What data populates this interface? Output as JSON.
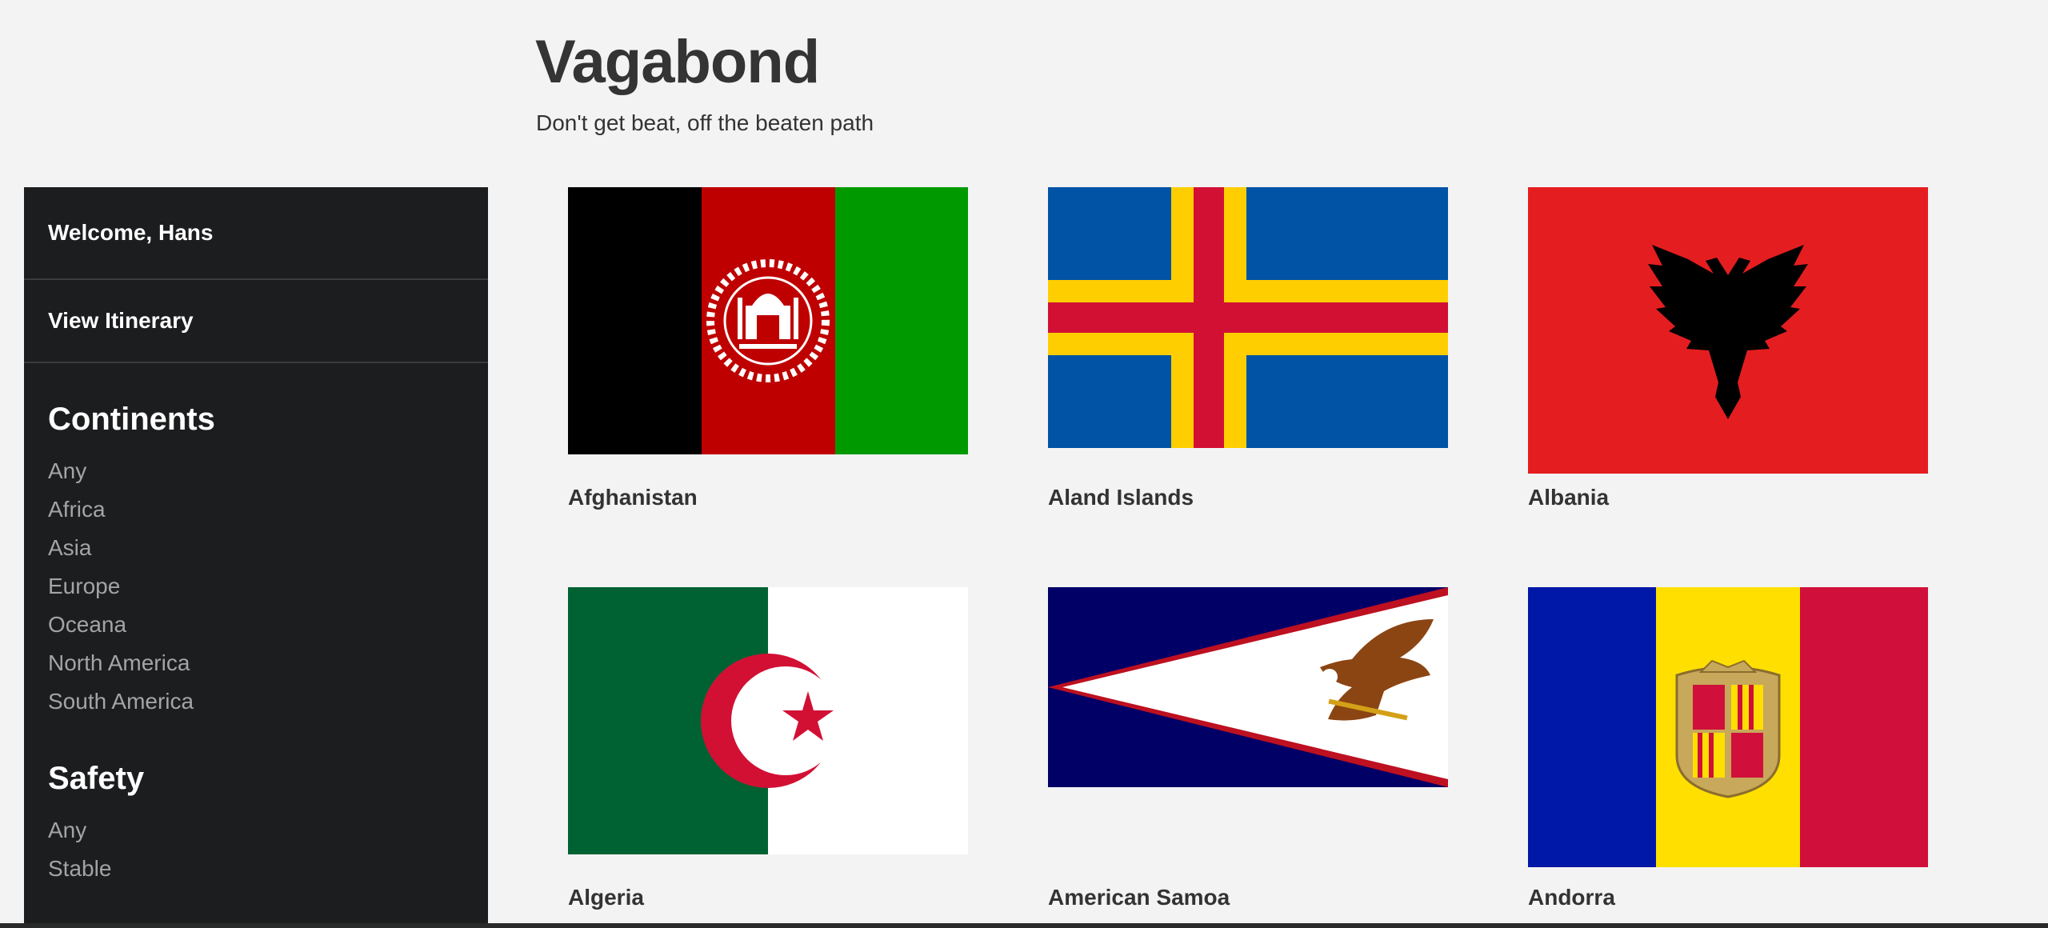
{
  "site": {
    "title": "Vagabond",
    "tagline": "Don't get beat, off the beaten path"
  },
  "sidebar": {
    "welcome": "Welcome, Hans",
    "itinerary": "View Itinerary",
    "continents_heading": "Continents",
    "continents": [
      "Any",
      "Africa",
      "Asia",
      "Europe",
      "Oceana",
      "North America",
      "South America"
    ],
    "safety_heading": "Safety",
    "safety": [
      "Any",
      "Stable"
    ]
  },
  "countries": [
    {
      "name": "Afghanistan",
      "flag_icon": "afghanistan-flag-icon"
    },
    {
      "name": "Aland Islands",
      "flag_icon": "aland-islands-flag-icon"
    },
    {
      "name": "Albania",
      "flag_icon": "albania-flag-icon"
    },
    {
      "name": "Algeria",
      "flag_icon": "algeria-flag-icon"
    },
    {
      "name": "American Samoa",
      "flag_icon": "american-samoa-flag-icon"
    },
    {
      "name": "Andorra",
      "flag_icon": "andorra-flag-icon"
    }
  ],
  "colors": {
    "page_bg": "#f3f3f3",
    "sidebar_bg": "#1c1d1f",
    "sidebar_link": "#a4a4a4"
  }
}
